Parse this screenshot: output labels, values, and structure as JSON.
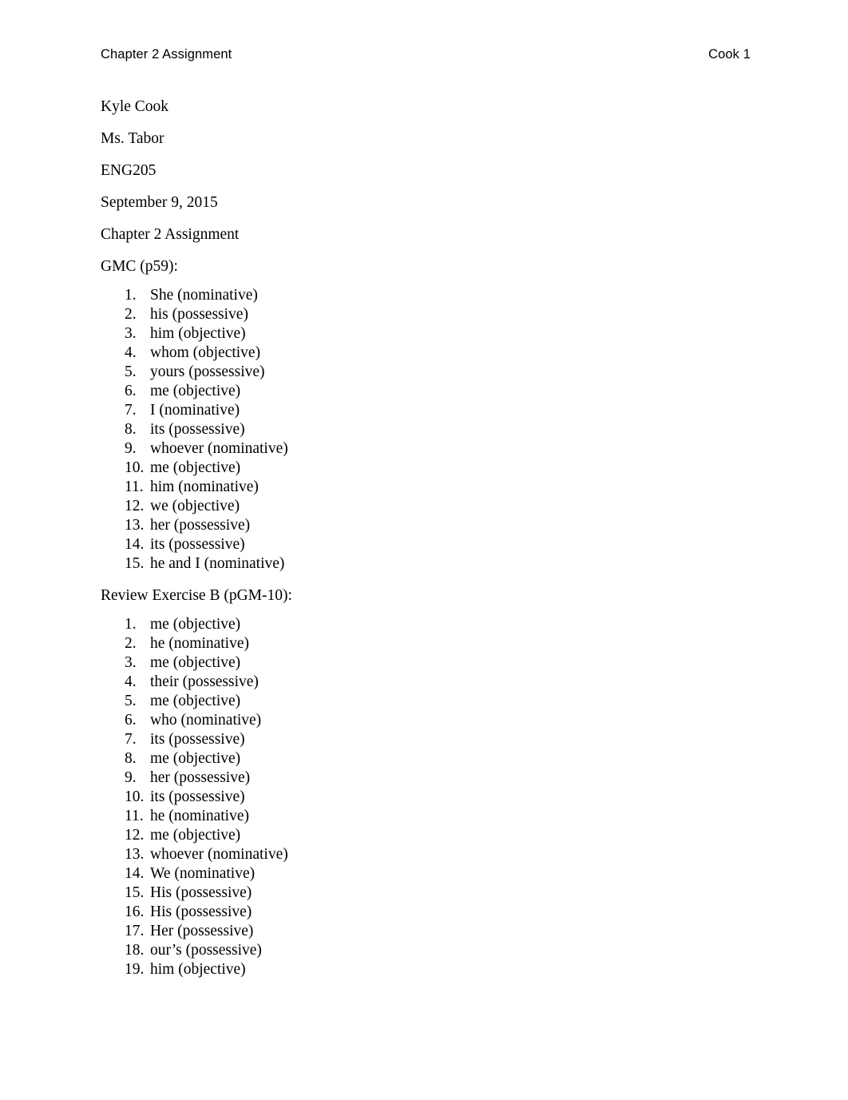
{
  "header": {
    "left": "Chapter 2 Assignment",
    "right": "Cook 1"
  },
  "body": {
    "name": "Kyle Cook",
    "instructor": "Ms. Tabor",
    "course": "ENG205",
    "date": "September 9, 2015",
    "title": "Chapter 2 Assignment"
  },
  "sections": [
    {
      "heading": "GMC (p59):",
      "items": [
        {
          "num": "1.",
          "text": "She (nominative)"
        },
        {
          "num": "2.",
          "text": "his (possessive)"
        },
        {
          "num": "3.",
          "text": "him (objective)"
        },
        {
          "num": "4.",
          "text": "whom (objective)"
        },
        {
          "num": "5.",
          "text": "yours (possessive)"
        },
        {
          "num": "6.",
          "text": "me (objective)"
        },
        {
          "num": "7.",
          "text": "I (nominative)"
        },
        {
          "num": "8.",
          "text": "its (possessive)"
        },
        {
          "num": "9.",
          "text": "whoever (nominative)"
        },
        {
          "num": "10.",
          "text": "me (objective)"
        },
        {
          "num": "11.",
          "text": "him (nominative)"
        },
        {
          "num": "12.",
          "text": "we (objective)"
        },
        {
          "num": "13.",
          "text": "her (possessive)"
        },
        {
          "num": "14.",
          "text": "its (possessive)"
        },
        {
          "num": "15.",
          "text": "he and I (nominative)"
        }
      ]
    },
    {
      "heading": "Review Exercise B (pGM-10):",
      "items": [
        {
          "num": "1.",
          "text": "me (objective)"
        },
        {
          "num": "2.",
          "text": "he (nominative)"
        },
        {
          "num": "3.",
          "text": "me (objective)"
        },
        {
          "num": "4.",
          "text": "their (possessive)"
        },
        {
          "num": "5.",
          "text": "me (objective)"
        },
        {
          "num": "6.",
          "text": "who (nominative)"
        },
        {
          "num": "7.",
          "text": "its (possessive)"
        },
        {
          "num": "8.",
          "text": "me (objective)"
        },
        {
          "num": "9.",
          "text": "her (possessive)"
        },
        {
          "num": "10.",
          "text": "its (possessive)"
        },
        {
          "num": "11.",
          "text": "he (nominative)"
        },
        {
          "num": "12.",
          "text": "me (objective)"
        },
        {
          "num": "13.",
          "text": "whoever (nominative)"
        },
        {
          "num": "14.",
          "text": "We (nominative)"
        },
        {
          "num": "15.",
          "text": "His (possessive)"
        },
        {
          "num": "16.",
          "text": "His (possessive)"
        },
        {
          "num": "17.",
          "text": "Her (possessive)"
        },
        {
          "num": "18.",
          "text": "our’s (possessive)"
        },
        {
          "num": "19.",
          "text": "him (objective)"
        }
      ]
    }
  ],
  "colors": {
    "page_background": "#ffffff",
    "text": "#000000"
  }
}
